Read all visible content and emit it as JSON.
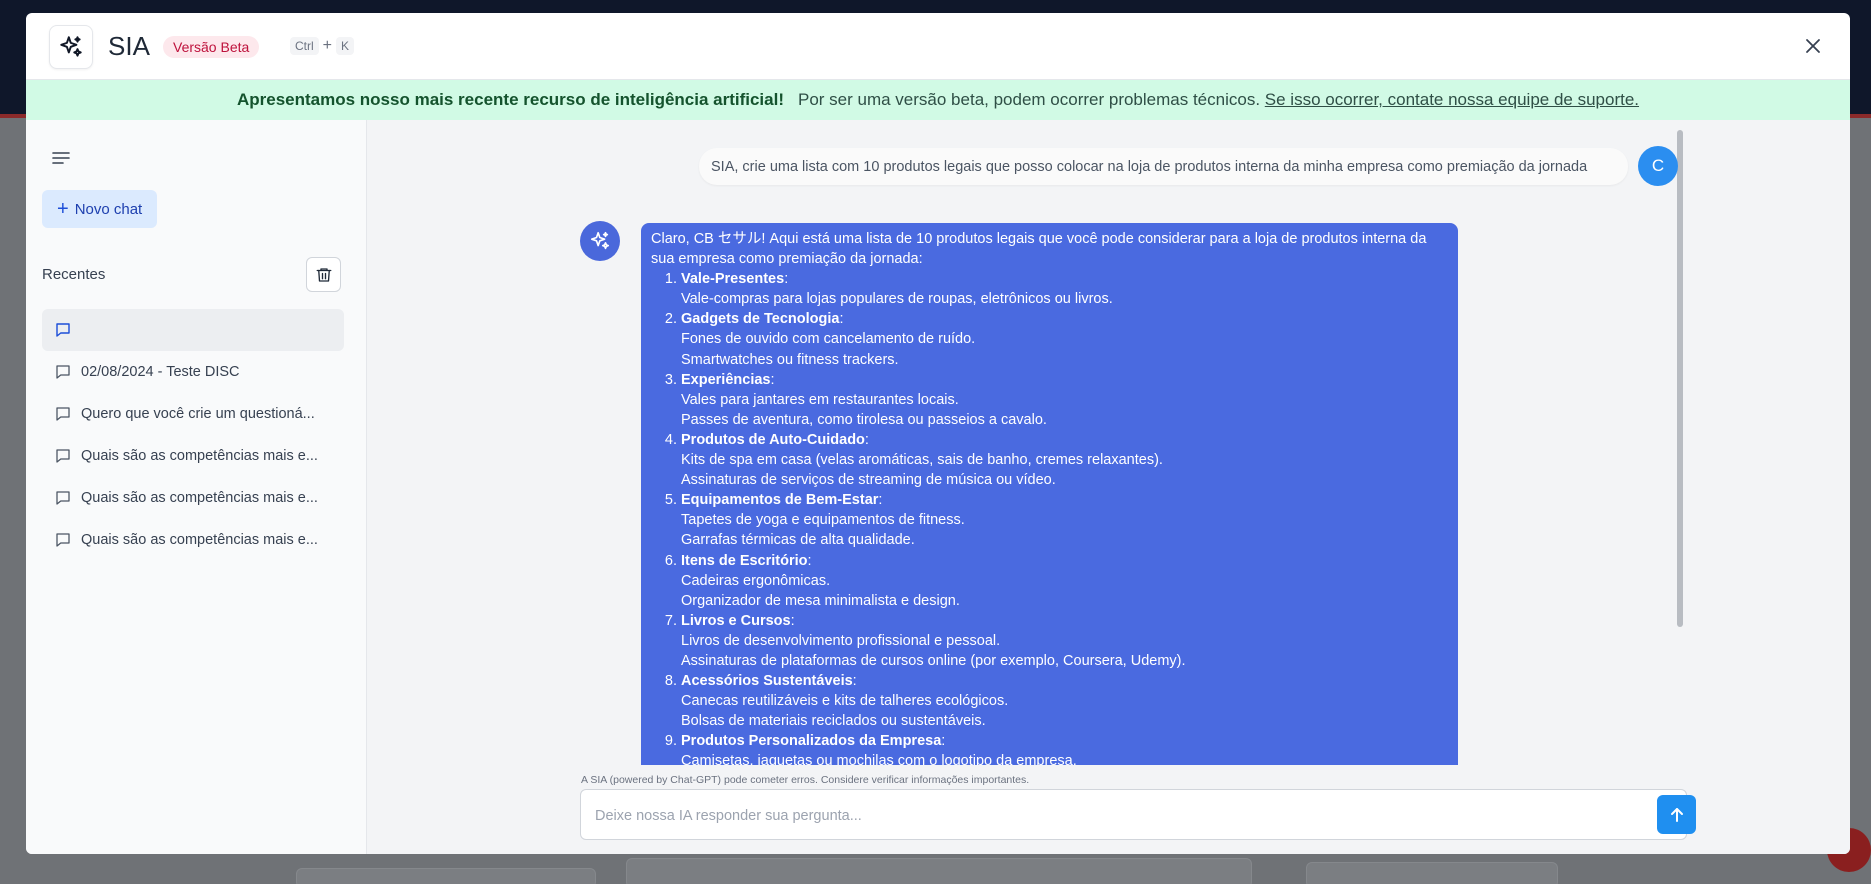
{
  "header": {
    "title": "SIA",
    "badge": "Versão Beta",
    "shortcut_key1": "Ctrl",
    "shortcut_plus": "+",
    "shortcut_key2": "K"
  },
  "banner": {
    "strong": "Apresentamos nosso mais recente recurso de inteligência artificial!",
    "text": "Por ser uma versão beta, podem ocorrer problemas técnicos.",
    "link": "Se isso ocorrer, contate nossa equipe de suporte."
  },
  "sidebar": {
    "new_chat_label": "Novo chat",
    "recent_label": "Recentes",
    "items": [
      {
        "label": "",
        "active": true
      },
      {
        "label": "02/08/2024 - Teste DISC",
        "active": false
      },
      {
        "label": "Quero que você crie um questioná...",
        "active": false
      },
      {
        "label": "Quais são as competências mais e...",
        "active": false
      },
      {
        "label": "Quais são as competências mais e...",
        "active": false
      },
      {
        "label": "Quais são as competências mais e...",
        "active": false
      }
    ]
  },
  "chat": {
    "user_message": "SIA, crie uma lista com 10 produtos legais que posso colocar na loja de produtos interna da minha empresa como premiação da jornada",
    "user_initial": "C",
    "bot_intro": "Claro, CB セサル! Aqui está uma lista de 10 produtos legais que você pode considerar para a loja de produtos interna da sua empresa como premiação da jornada:",
    "bot_items": [
      {
        "title": "Vale-Presentes",
        "lines": [
          "Vale-compras para lojas populares de roupas, eletrônicos ou livros."
        ]
      },
      {
        "title": "Gadgets de Tecnologia",
        "lines": [
          "Fones de ouvido com cancelamento de ruído.",
          "Smartwatches ou fitness trackers."
        ]
      },
      {
        "title": "Experiências",
        "lines": [
          "Vales para jantares em restaurantes locais.",
          "Passes de aventura, como tirolesa ou passeios a cavalo."
        ]
      },
      {
        "title": "Produtos de Auto-Cuidado",
        "lines": [
          "Kits de spa em casa (velas aromáticas, sais de banho, cremes relaxantes).",
          "Assinaturas de serviços de streaming de música ou vídeo."
        ]
      },
      {
        "title": "Equipamentos de Bem-Estar",
        "lines": [
          "Tapetes de yoga e equipamentos de fitness.",
          "Garrafas térmicas de alta qualidade."
        ]
      },
      {
        "title": "Itens de Escritório",
        "lines": [
          "Cadeiras ergonômicas.",
          "Organizador de mesa minimalista e design."
        ]
      },
      {
        "title": "Livros e Cursos",
        "lines": [
          "Livros de desenvolvimento profissional e pessoal.",
          "Assinaturas de plataformas de cursos online (por exemplo, Coursera, Udemy)."
        ]
      },
      {
        "title": "Acessórios Sustentáveis",
        "lines": [
          "Canecas reutilizáveis e kits de talheres ecológicos.",
          "Bolsas de materiais reciclados ou sustentáveis."
        ]
      },
      {
        "title": "Produtos Personalizados da Empresa",
        "lines": [
          "Camisetas, jaquetas ou mochilas com o logotipo da empresa."
        ]
      }
    ],
    "disclaimer": "A SIA (powered by Chat-GPT) pode cometer erros. Considere verificar informações importantes.",
    "input_placeholder": "Deixe nossa IA responder sua pergunta..."
  },
  "colors": {
    "accent": "#2b8ef0",
    "bot_bubble": "#4a6ae0",
    "banner_bg": "#d1fae5",
    "badge_text": "#be123c"
  },
  "icons": {
    "logo": "sparkles-icon",
    "close": "close-icon",
    "menu": "menu-lines-icon",
    "trash": "trash-icon",
    "chat": "chat-bubble-icon",
    "send": "arrow-up-icon"
  }
}
